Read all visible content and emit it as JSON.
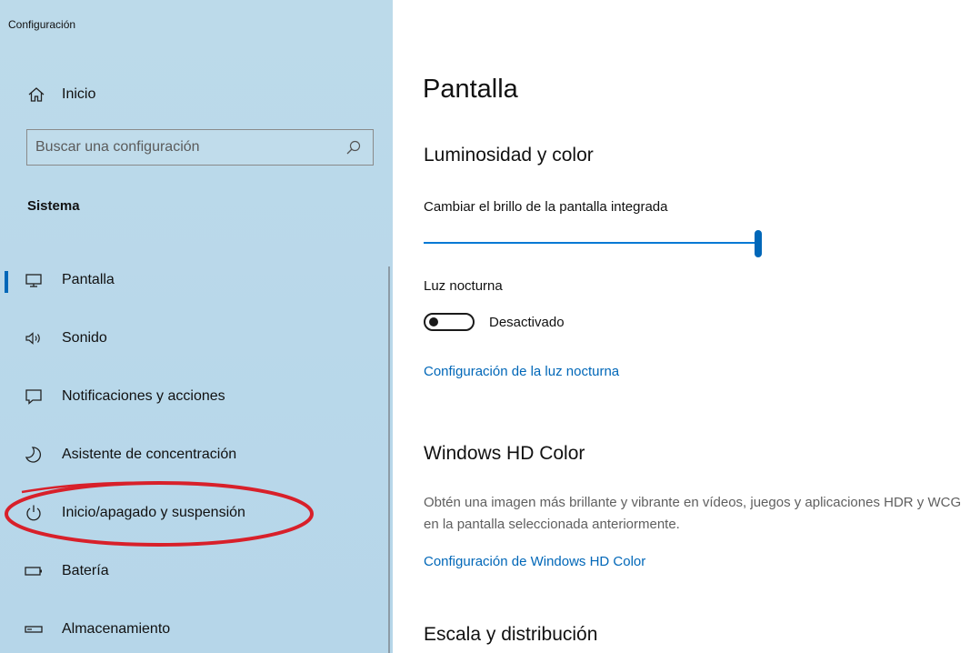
{
  "window": {
    "title": "Configuración"
  },
  "sidebar": {
    "home_label": "Inicio",
    "search": {
      "placeholder": "Buscar una configuración",
      "value": ""
    },
    "section_label": "Sistema",
    "items": [
      {
        "label": "Pantalla",
        "icon": "monitor-icon",
        "active": true
      },
      {
        "label": "Sonido",
        "icon": "speaker-icon",
        "active": false
      },
      {
        "label": "Notificaciones y acciones",
        "icon": "notification-icon",
        "active": false
      },
      {
        "label": "Asistente de concentración",
        "icon": "moon-icon",
        "active": false
      },
      {
        "label": "Inicio/apagado y suspensión",
        "icon": "power-icon",
        "active": false
      },
      {
        "label": "Batería",
        "icon": "battery-icon",
        "active": false
      },
      {
        "label": "Almacenamiento",
        "icon": "storage-icon",
        "active": false
      }
    ]
  },
  "main": {
    "page_title": "Pantalla",
    "brightness_section": {
      "header": "Luminosidad y color",
      "brightness_label": "Cambiar el brillo de la pantalla integrada",
      "brightness_value_percent": 100,
      "night_light_label": "Luz nocturna",
      "night_light_state": "Desactivado",
      "night_light_on": false,
      "night_light_link": "Configuración de la luz nocturna"
    },
    "hd_color_section": {
      "header": "Windows HD Color",
      "description": "Obtén una imagen más brillante y vibrante en vídeos, juegos y aplicaciones HDR y WCG en la pantalla seleccionada anteriormente.",
      "link": "Configuración de Windows HD Color"
    },
    "scale_section": {
      "header": "Escala y distribución"
    }
  },
  "colors": {
    "sidebar_bg": "#b9d8ea",
    "accent": "#0067b8",
    "annotation": "#d8202a"
  }
}
